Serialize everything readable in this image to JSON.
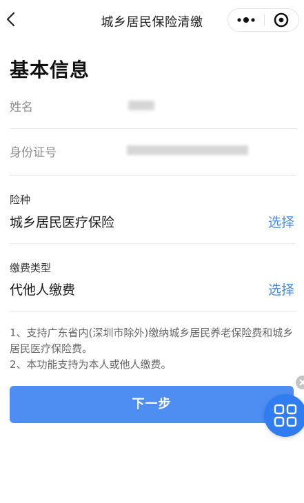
{
  "nav": {
    "title": "城乡居民保险清缴",
    "back_icon": "chevron-left-icon",
    "more_icon": "more-dots-icon",
    "close_icon": "target-circle-icon"
  },
  "basic_info": {
    "title": "基本信息",
    "name_label": "姓名",
    "id_label": "身份证号"
  },
  "insurance_type": {
    "label": "险种",
    "value": "城乡居民医疗保险",
    "action": "选择"
  },
  "payment_type": {
    "label": "缴费类型",
    "value": "代他人缴费",
    "action": "选择"
  },
  "notes": [
    "1、支持广东省内(深圳市除外)缴纳城乡居民养老保险费和城乡居民医疗保险费。",
    "2、本功能支持为本人或他人缴费。"
  ],
  "next_button": "下一步",
  "floating": {
    "icon": "grid-apps-icon",
    "close_icon": "close-icon"
  },
  "colors": {
    "accent": "#4e8df2",
    "link": "#4a8ee8",
    "float_button": "#2f7df0"
  }
}
